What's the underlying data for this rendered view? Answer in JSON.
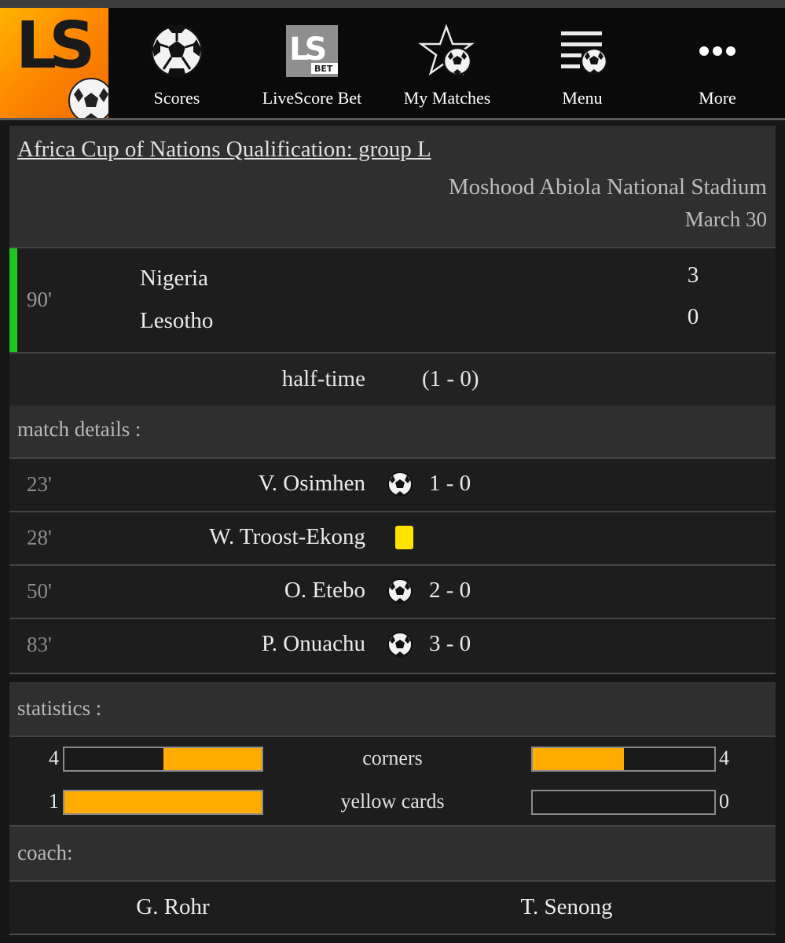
{
  "nav": {
    "logo_text": "LS",
    "items": [
      {
        "label": "Scores",
        "icon": "soccer-ball-icon"
      },
      {
        "label": "LiveScore Bet",
        "icon": "livescore-bet-icon"
      },
      {
        "label": "My Matches",
        "icon": "star-ball-icon"
      },
      {
        "label": "Menu",
        "icon": "menu-ball-icon"
      },
      {
        "label": "More",
        "icon": "more-dots-icon"
      }
    ],
    "bet_badge": "BET",
    "bet_logo": "LS"
  },
  "match": {
    "competition": "Africa Cup of Nations Qualification: group L",
    "stadium": "Moshood Abiola National Stadium",
    "date": "March 30",
    "minute": "90'",
    "home_team": "Nigeria",
    "away_team": "Lesotho",
    "home_score": "3",
    "away_score": "0",
    "status_color": "#1fc71f",
    "halftime_label": "half-time",
    "halftime_score": "(1 - 0)"
  },
  "details": {
    "title": "match details :",
    "events": [
      {
        "minute": "23'",
        "player": "V. Osimhen",
        "type": "goal",
        "score": "1 - 0"
      },
      {
        "minute": "28'",
        "player": "W. Troost-Ekong",
        "type": "yellow-card",
        "score": ""
      },
      {
        "minute": "50'",
        "player": "O. Etebo",
        "type": "goal",
        "score": "2 - 0"
      },
      {
        "minute": "83'",
        "player": "P. Onuachu",
        "type": "goal",
        "score": "3 - 0"
      }
    ]
  },
  "statistics": {
    "title": "statistics :",
    "bar_color": "#ffab00",
    "rows": [
      {
        "label": "corners",
        "home": "4",
        "away": "4",
        "home_fill": 0.5,
        "away_fill": 0.5
      },
      {
        "label": "yellow cards",
        "home": "1",
        "away": "0",
        "home_fill": 1.0,
        "away_fill": 0.0
      }
    ]
  },
  "coach": {
    "title": "coach:",
    "home": "G. Rohr",
    "away": "T. Senong"
  }
}
